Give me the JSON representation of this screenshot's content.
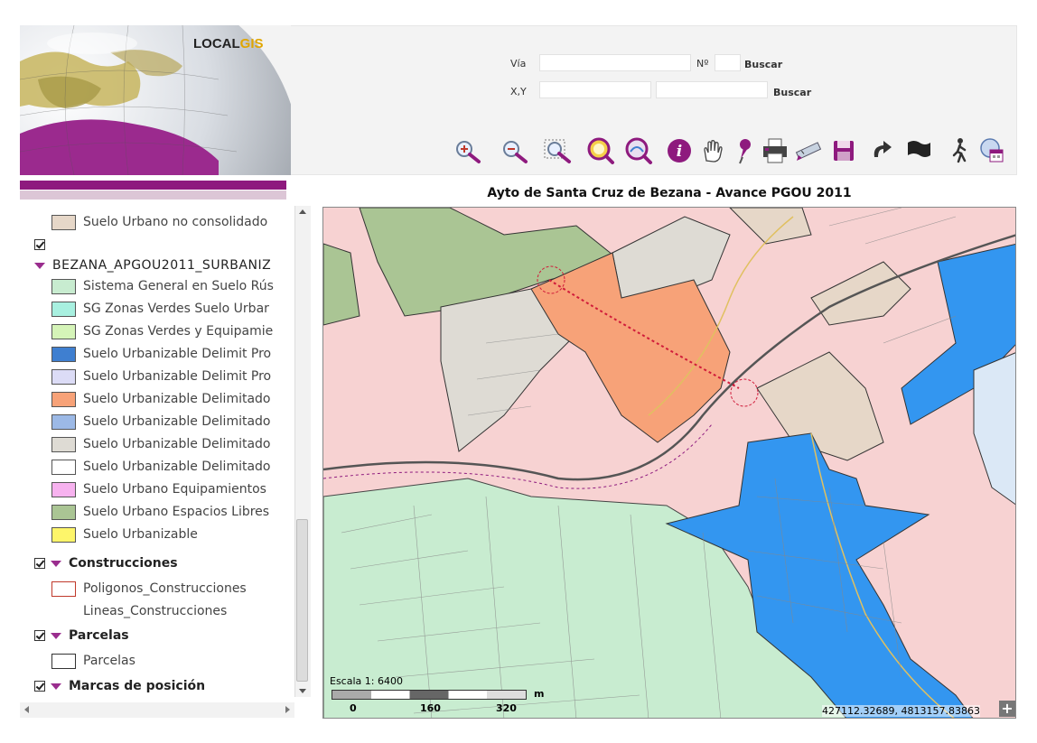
{
  "app": {
    "logo_part1": "LOCAL",
    "logo_part2": "GIS",
    "colors": {
      "accent": "#8e1a7e",
      "logo_gis": "#e0a500"
    }
  },
  "search": {
    "via_label": "Vía",
    "num_label": "Nº",
    "buscar1_label": "Buscar",
    "xy_label": "X,Y",
    "buscar2_label": "Buscar",
    "via_value": "",
    "num_value": "",
    "x_value": "",
    "y_value": ""
  },
  "toolbar": {
    "tools": [
      "zoom-in-icon",
      "zoom-out-icon",
      "zoom-box-icon",
      "zoom-full-icon",
      "zoom-layer-icon",
      "info-icon",
      "pan-hand-icon",
      "pushpin-icon",
      "print-icon",
      "measure-icon",
      "save-icon",
      "redo-icon",
      "flag-icon",
      "walker-icon",
      "layers-calendar-icon"
    ]
  },
  "map": {
    "title": "Ayto de Santa Cruz de Bezana - Avance PGOU 2011",
    "scale_label": "Escala 1: 6400",
    "scale_unit": "m",
    "scale_ticks": [
      "0",
      "160",
      "320"
    ],
    "coords": "427112.32689, 4813157.83863",
    "plus": "+"
  },
  "legend": {
    "items": [
      {
        "type": "item",
        "label": "Suelo Urbano no consolidado",
        "color": "#e6d7c8"
      },
      {
        "type": "check",
        "label": ""
      },
      {
        "type": "group",
        "label": "BEZANA_APGOU2011_SURBANIZ",
        "checked": false
      },
      {
        "type": "item",
        "label": "Sistema General en Suelo Rús",
        "color": "#c8ecd0"
      },
      {
        "type": "item",
        "label": "SG Zonas Verdes Suelo Urbar",
        "color": "#a8f0e0"
      },
      {
        "type": "item",
        "label": "SG Zonas Verdes y Equipamie",
        "color": "#d5f4b8"
      },
      {
        "type": "item",
        "label": "Suelo Urbanizable Delimit Pro",
        "color": "#3f7fd0"
      },
      {
        "type": "item",
        "label": "Suelo Urbanizable Delimit Pro",
        "color": "#dcdcf6"
      },
      {
        "type": "item",
        "label": "Suelo Urbanizable Delimitado",
        "color": "#f7a278"
      },
      {
        "type": "item",
        "label": "Suelo Urbanizable Delimitado",
        "color": "#9cb9e6"
      },
      {
        "type": "item",
        "label": "Suelo Urbanizable Delimitado",
        "color": "#dedbd4"
      },
      {
        "type": "item",
        "label": "Suelo Urbanizable Delimitado",
        "color": "#ffffff"
      },
      {
        "type": "item",
        "label": "Suelo Urbano Equipamientos",
        "color": "#f7b2ef"
      },
      {
        "type": "item",
        "label": "Suelo Urbano Espacios Libres",
        "color": "#aac594"
      },
      {
        "type": "item",
        "label": "Suelo Urbanizable",
        "color": "#fdf56a"
      },
      {
        "type": "group",
        "label": "Construcciones",
        "checked": true
      },
      {
        "type": "item",
        "label": "Poligonos_Construcciones",
        "color": "#ffffff",
        "border": "#c0392b"
      },
      {
        "type": "text",
        "label": "Lineas_Construcciones"
      },
      {
        "type": "group",
        "label": "Parcelas",
        "checked": true
      },
      {
        "type": "item",
        "label": "Parcelas",
        "color": "#ffffff",
        "border": "#333333"
      },
      {
        "type": "group",
        "label": "Marcas de posición",
        "checked": true
      }
    ]
  }
}
